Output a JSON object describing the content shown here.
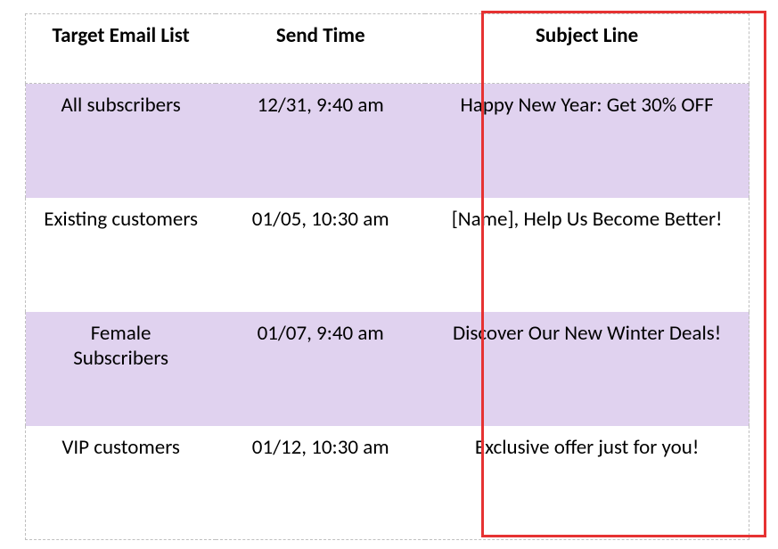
{
  "table": {
    "headers": [
      "Target Email List",
      "Send Time",
      "Subject Line"
    ],
    "rows": [
      {
        "target": "All subscribers",
        "send_time": "12/31, 9:40 am",
        "subject": "Happy New Year: Get 30% OFF",
        "highlighted": true
      },
      {
        "target": "Existing customers",
        "send_time": "01/05, 10:30 am",
        "subject": "[Name], Help Us Become Better!",
        "highlighted": false
      },
      {
        "target": "Female Subscribers",
        "send_time": "01/07, 9:40 am",
        "subject": "Discover Our New Winter Deals!",
        "highlighted": true
      },
      {
        "target": "VIP customers",
        "send_time": "01/12, 10:30 am",
        "subject": "Exclusive offer just for you!",
        "highlighted": false
      }
    ]
  }
}
